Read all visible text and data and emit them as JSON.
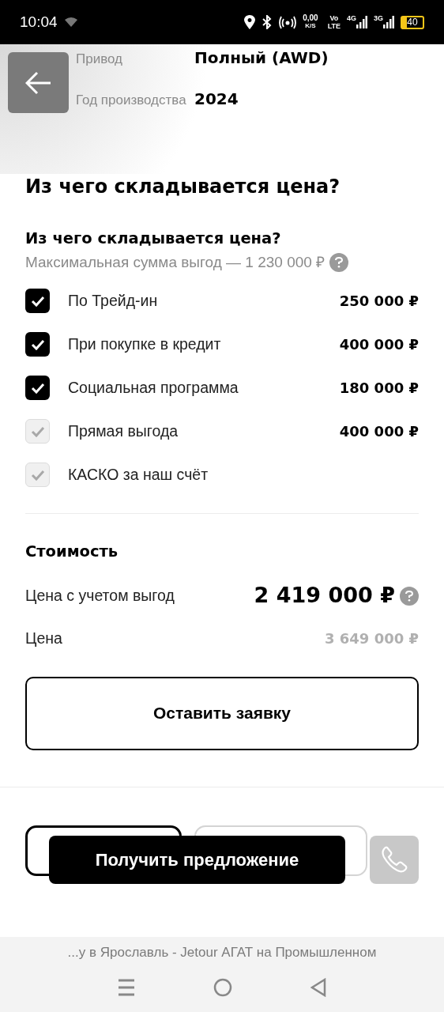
{
  "status_bar": {
    "time": "10:04",
    "speed": "0,00",
    "speed_unit": "K/S",
    "volte_top": "Vo",
    "volte_bottom": "LTE",
    "net_1": "4G",
    "net_2": "3G",
    "battery": "40"
  },
  "specs": [
    {
      "label": "Привод",
      "value": "Полный (AWD)"
    },
    {
      "label": "Год производства",
      "value": "2024"
    }
  ],
  "section_title": "Из чего складывается цена?",
  "benefits": {
    "title": "Из чего складывается цена?",
    "subtitle": "Максимальная сумма выгод — 1 230 000 ₽",
    "items": [
      {
        "label": "По Трейд-ин",
        "amount": "250 000 ₽",
        "checked": true,
        "disabled": false
      },
      {
        "label": "При покупке в кредит",
        "amount": "400 000 ₽",
        "checked": true,
        "disabled": false
      },
      {
        "label": "Социальная программа",
        "amount": "180 000 ₽",
        "checked": true,
        "disabled": false
      },
      {
        "label": "Прямая выгода",
        "amount": "400 000 ₽",
        "checked": true,
        "disabled": true
      },
      {
        "label": "КАСКО за наш счёт",
        "checked": true,
        "disabled": true
      }
    ]
  },
  "cost": {
    "title": "Стоимость",
    "rows": [
      {
        "kind": "main",
        "label": "Цена с учетом выгод",
        "value": "2 419 000 ₽"
      },
      {
        "kind": "old",
        "label": "Цена",
        "value": "3 649 000 ₽"
      }
    ]
  },
  "request_button": "Оставить заявку",
  "offer_button": "Получить предложение",
  "browser_bar": {
    "title": "...у в Ярославль - Jetour АГАТ на Промышленном"
  }
}
